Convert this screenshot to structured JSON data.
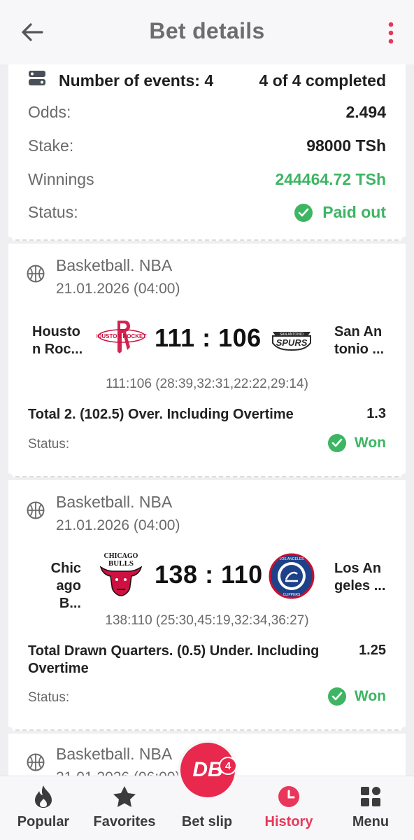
{
  "header": {
    "title": "Bet details"
  },
  "summary": {
    "events_label": "Number of events: 4",
    "completed": "4 of 4 completed",
    "odds_label": "Odds:",
    "odds_value": "2.494",
    "stake_label": "Stake:",
    "stake_value": "98000 TSh",
    "winnings_label": "Winnings",
    "winnings_value": "244464.72 TSh",
    "status_label": "Status:",
    "status_value": "Paid out"
  },
  "events": [
    {
      "sport": "Basketball. NBA",
      "date": "21.01.2026 (04:00)",
      "home_l1": "Housto",
      "home_l2": "n Roc...",
      "away_l1": "San An",
      "away_l2": "tonio ...",
      "score": "111 : 106",
      "periods": "111:106 (28:39,32:31,22:22,29:14)",
      "market_l1": "Total 2. (102.5) Over. Including Overtime",
      "market_l2": "",
      "coef": "1.3",
      "status_label": "Status:",
      "status_value": "Won"
    },
    {
      "sport": "Basketball. NBA",
      "date": "21.01.2026 (04:00)",
      "home_l1": "Chic",
      "home_l2": "ago B...",
      "away_l1": "Los An",
      "away_l2": "geles ...",
      "score": "138 : 110",
      "periods": "138:110 (25:30,45:19,32:34,36:27)",
      "market_l1": "Total Drawn Quarters. (0.5) Under. Including",
      "market_l2": "Overtime",
      "coef": "1.25",
      "status_label": "Status:",
      "status_value": "Won"
    },
    {
      "sport": "Basketball. NBA",
      "date": "21.01.2026 (06:00)"
    }
  ],
  "logos": {
    "rockets": "HOUSTON ROCKETS",
    "spurs": "SAN ANTONIO SPURS",
    "bulls": "CHICAGO BULLS",
    "clippers": "LOS ANGELES CLIPPERS"
  },
  "bottom_nav": {
    "popular": "Popular",
    "favorites": "Favorites",
    "betslip": "Bet slip",
    "history": "History",
    "menu": "Menu",
    "fab_logo": "DB",
    "badge_count": "4"
  },
  "colors": {
    "accent": "#e8284c",
    "win": "#3db563"
  }
}
